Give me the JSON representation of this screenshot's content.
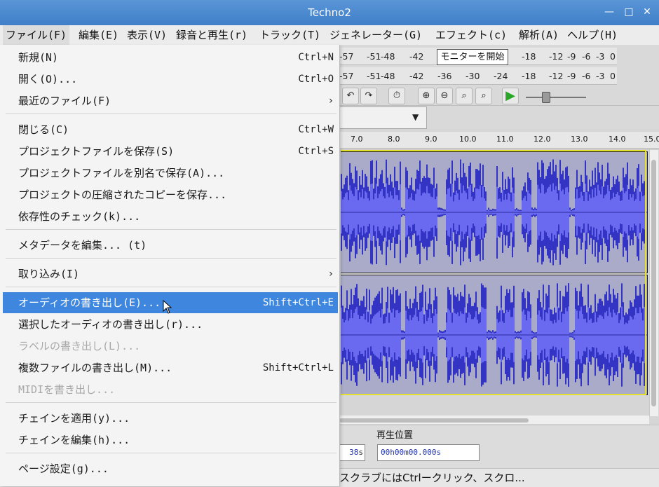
{
  "window": {
    "title": "Techno2"
  },
  "menubar": [
    "ファイル(F)",
    "編集(E)",
    "表示(V)",
    "録音と再生(r)",
    "トラック(T)",
    "ジェネレーター(G)",
    "エフェクト(c)",
    "解析(A)",
    "ヘルプ(H)"
  ],
  "file_menu": {
    "items": [
      {
        "label": "新規(N)",
        "shortcut": "Ctrl+N"
      },
      {
        "label": "開く(O)...",
        "shortcut": "Ctrl+O"
      },
      {
        "label": "最近のファイル(F)",
        "submenu": "›"
      },
      {
        "label": "閉じる(C)",
        "shortcut": "Ctrl+W"
      },
      {
        "label": "プロジェクトファイルを保存(S)",
        "shortcut": "Ctrl+S"
      },
      {
        "label": "プロジェクトファイルを別名で保存(A)..."
      },
      {
        "label": "プロジェクトの圧縮されたコピーを保存..."
      },
      {
        "label": "依存性のチェック(k)..."
      },
      {
        "label": "メタデータを編集... (t)"
      },
      {
        "label": "取り込み(I)",
        "submenu": "›"
      },
      {
        "label": "オーディオの書き出し(E)...",
        "shortcut": "Shift+Ctrl+E",
        "state": "highlighted"
      },
      {
        "label": "選択したオーディオの書き出し(r)..."
      },
      {
        "label": "ラベルの書き出し(L)...",
        "state": "disabled"
      },
      {
        "label": "複数ファイルの書き出し(M)...",
        "shortcut": "Shift+Ctrl+L"
      },
      {
        "label": "MIDIを書き出し...",
        "state": "disabled"
      },
      {
        "label": "チェインを適用(y)..."
      },
      {
        "label": "チェインを編集(h)..."
      },
      {
        "label": "ページ設定(g)..."
      }
    ]
  },
  "meters": {
    "row1": [
      "-57",
      "-51",
      "-48",
      "-42",
      "-18",
      "-12",
      "-9",
      "-6",
      "-3",
      "0"
    ],
    "row2": [
      "-57",
      "-51",
      "-48",
      "-42",
      "-36",
      "-30",
      "-24",
      "-18",
      "-12",
      "-9",
      "-6",
      "-3",
      "0"
    ],
    "tooltip": "モニターを開始"
  },
  "ruler": [
    "7.0",
    "8.0",
    "9.0",
    "10.0",
    "11.0",
    "12.0",
    "13.0",
    "14.0",
    "15.0"
  ],
  "toolbar_icons": [
    "undo-icon",
    "redo-icon",
    "sync-lock-icon",
    "zoom-in-icon",
    "zoom-out-icon",
    "fit-selection-icon",
    "fit-project-icon",
    "play-icon"
  ],
  "bottom": {
    "playback_position_label": "再生位置",
    "left_time_fragment": "38",
    "left_time_unit": "s",
    "position_value": "00h00m00.000s"
  },
  "status": "スクラブにはCtrlークリック、スクロ..."
}
